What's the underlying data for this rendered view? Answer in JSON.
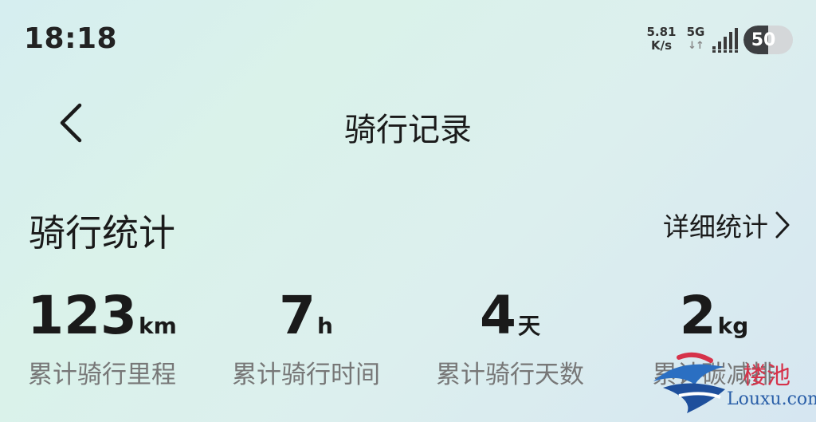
{
  "status_bar": {
    "time": "18:18",
    "net_speed_value": "5.81",
    "net_speed_unit": "K/s",
    "network_type": "5G",
    "network_arrows": "↓↑",
    "signal_icon": "signal-bars-icon",
    "battery_level": "50",
    "battery_fraction": 0.5
  },
  "header": {
    "back_icon": "chevron-left-icon",
    "title": "骑行记录"
  },
  "section": {
    "title": "骑行统计",
    "detail_link": "详细统计",
    "detail_icon": "chevron-right-icon"
  },
  "stats": [
    {
      "value": "123",
      "unit": "km",
      "label": "累计骑行里程"
    },
    {
      "value": "7",
      "unit": "h",
      "label": "累计骑行时间"
    },
    {
      "value": "4",
      "unit": "天",
      "label": "累计骑行天数"
    },
    {
      "value": "2",
      "unit": "kg",
      "label": "累计碳减排"
    }
  ],
  "watermark": {
    "cn": "楼池",
    "en": "Louxu.com"
  },
  "colors": {
    "background_start": "#d6eef0",
    "background_end": "#d6e6f1",
    "text_primary": "#1a1a1a",
    "text_secondary": "#777777",
    "battery_fill": "#3d3f42"
  }
}
